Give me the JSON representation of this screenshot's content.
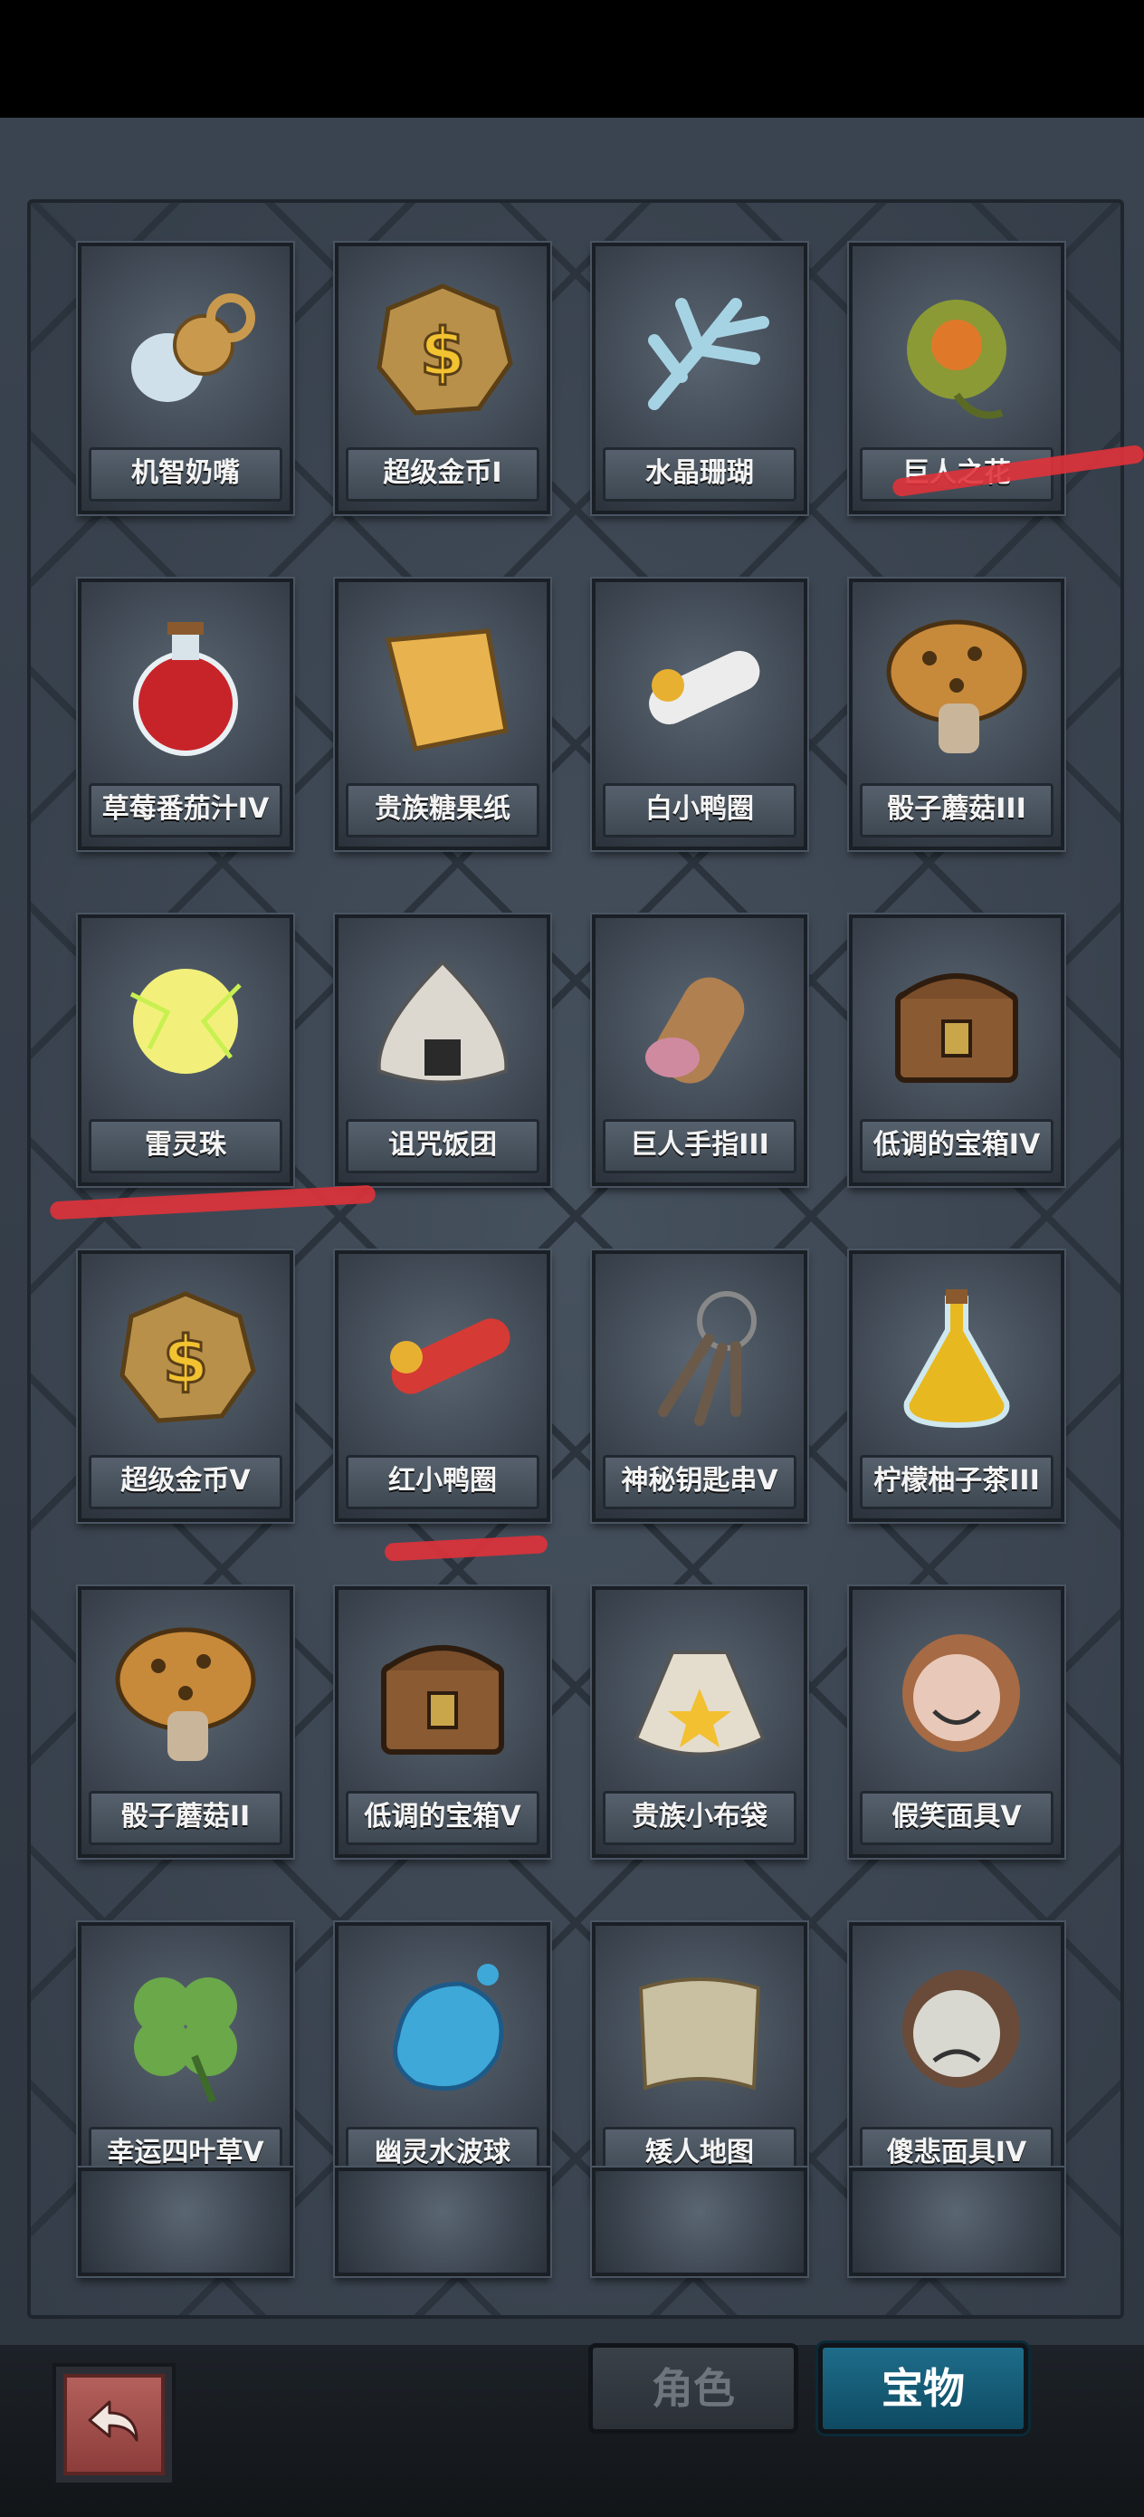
{
  "items": [
    {
      "label": "机智奶嘴",
      "icon": "pacifier-icon"
    },
    {
      "label": "超级金币I",
      "icon": "gold-coin-icon"
    },
    {
      "label": "水晶珊瑚",
      "icon": "crystal-coral-icon"
    },
    {
      "label": "巨人之花",
      "icon": "giant-flower-icon"
    },
    {
      "label": "草莓番茄汁IV",
      "icon": "potion-flask-icon"
    },
    {
      "label": "贵族糖果纸",
      "icon": "candy-wrapper-icon"
    },
    {
      "label": "白小鸭圈",
      "icon": "white-duck-ring-icon"
    },
    {
      "label": "骰子蘑菇III",
      "icon": "dice-mushroom-icon"
    },
    {
      "label": "雷灵珠",
      "icon": "thunder-orb-icon"
    },
    {
      "label": "诅咒饭团",
      "icon": "rice-ball-icon"
    },
    {
      "label": "巨人手指III",
      "icon": "giant-finger-icon"
    },
    {
      "label": "低调的宝箱IV",
      "icon": "treasure-chest-icon"
    },
    {
      "label": "超级金币V",
      "icon": "gold-coin-icon"
    },
    {
      "label": "红小鸭圈",
      "icon": "red-duck-ring-icon"
    },
    {
      "label": "神秘钥匙串V",
      "icon": "key-ring-icon"
    },
    {
      "label": "柠檬柚子茶III",
      "icon": "tea-bottle-icon"
    },
    {
      "label": "骰子蘑菇II",
      "icon": "dice-mushroom-icon"
    },
    {
      "label": "低调的宝箱V",
      "icon": "treasure-chest-icon"
    },
    {
      "label": "贵族小布袋",
      "icon": "cloth-bag-icon"
    },
    {
      "label": "假笑面具V",
      "icon": "smile-mask-icon"
    },
    {
      "label": "幸运四叶草V",
      "icon": "four-leaf-clover-icon"
    },
    {
      "label": "幽灵水波球",
      "icon": "water-orb-icon"
    },
    {
      "label": "矮人地图",
      "icon": "map-scroll-icon"
    },
    {
      "label": "傻悲面具IV",
      "icon": "sad-mask-icon"
    }
  ],
  "tabs": {
    "role_label": "角色",
    "treasure_label": "宝物",
    "active": "宝物"
  },
  "colors": {
    "active_tab": "#1e6d8a",
    "annotation_mark": "#e0323a",
    "back_button": "#b4605c"
  }
}
